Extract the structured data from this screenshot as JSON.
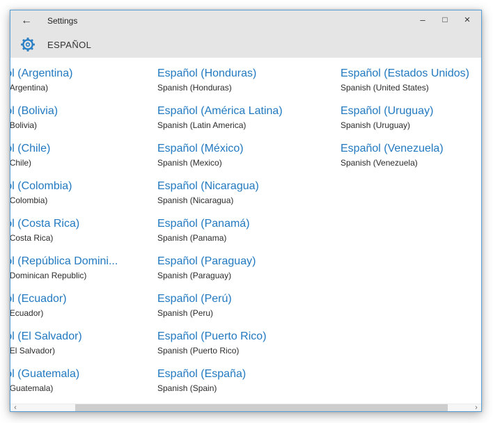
{
  "window": {
    "title_bar": {
      "title": "Settings"
    },
    "header": {
      "title": "ESPAÑOL"
    }
  },
  "icons": {
    "back": "←",
    "minimize": "–",
    "maximize": "□",
    "close": "×",
    "scroll_left": "‹",
    "scroll_right": "›"
  },
  "languages": {
    "columns": [
      [
        {
          "title": "Español (Argentina)",
          "subtitle": "Spanish (Argentina)"
        },
        {
          "title": "Español (Bolivia)",
          "subtitle": "Spanish (Bolivia)"
        },
        {
          "title": "Español (Chile)",
          "subtitle": "Spanish (Chile)"
        },
        {
          "title": "Español (Colombia)",
          "subtitle": "Spanish (Colombia)"
        },
        {
          "title": "Español (Costa Rica)",
          "subtitle": "Spanish (Costa Rica)"
        },
        {
          "title": "Español (República Domini...",
          "subtitle": "Spanish (Dominican Republic)"
        },
        {
          "title": "Español (Ecuador)",
          "subtitle": "Spanish (Ecuador)"
        },
        {
          "title": "Español (El Salvador)",
          "subtitle": "Spanish (El Salvador)"
        },
        {
          "title": "Español (Guatemala)",
          "subtitle": "Spanish (Guatemala)"
        }
      ],
      [
        {
          "title": "Español (Honduras)",
          "subtitle": "Spanish (Honduras)"
        },
        {
          "title": "Español (América Latina)",
          "subtitle": "Spanish (Latin America)"
        },
        {
          "title": "Español (México)",
          "subtitle": "Spanish (Mexico)"
        },
        {
          "title": "Español (Nicaragua)",
          "subtitle": "Spanish (Nicaragua)"
        },
        {
          "title": "Español (Panamá)",
          "subtitle": "Spanish (Panama)"
        },
        {
          "title": "Español (Paraguay)",
          "subtitle": "Spanish (Paraguay)"
        },
        {
          "title": "Español (Perú)",
          "subtitle": "Spanish (Peru)"
        },
        {
          "title": "Español (Puerto Rico)",
          "subtitle": "Spanish (Puerto Rico)"
        },
        {
          "title": "Español (España)",
          "subtitle": "Spanish (Spain)"
        }
      ],
      [
        {
          "title": "Español (Estados Unidos)",
          "subtitle": "Spanish (United States)"
        },
        {
          "title": "Español (Uruguay)",
          "subtitle": "Spanish (Uruguay)"
        },
        {
          "title": "Español (Venezuela)",
          "subtitle": "Spanish (Venezuela)"
        }
      ]
    ]
  },
  "colors": {
    "accent_blue": "#2a80c5",
    "link_blue": "#2279c0",
    "header_bg": "#e5e5e5",
    "window_border": "#579fd4",
    "scrollbar_thumb": "#cdcdcd"
  }
}
